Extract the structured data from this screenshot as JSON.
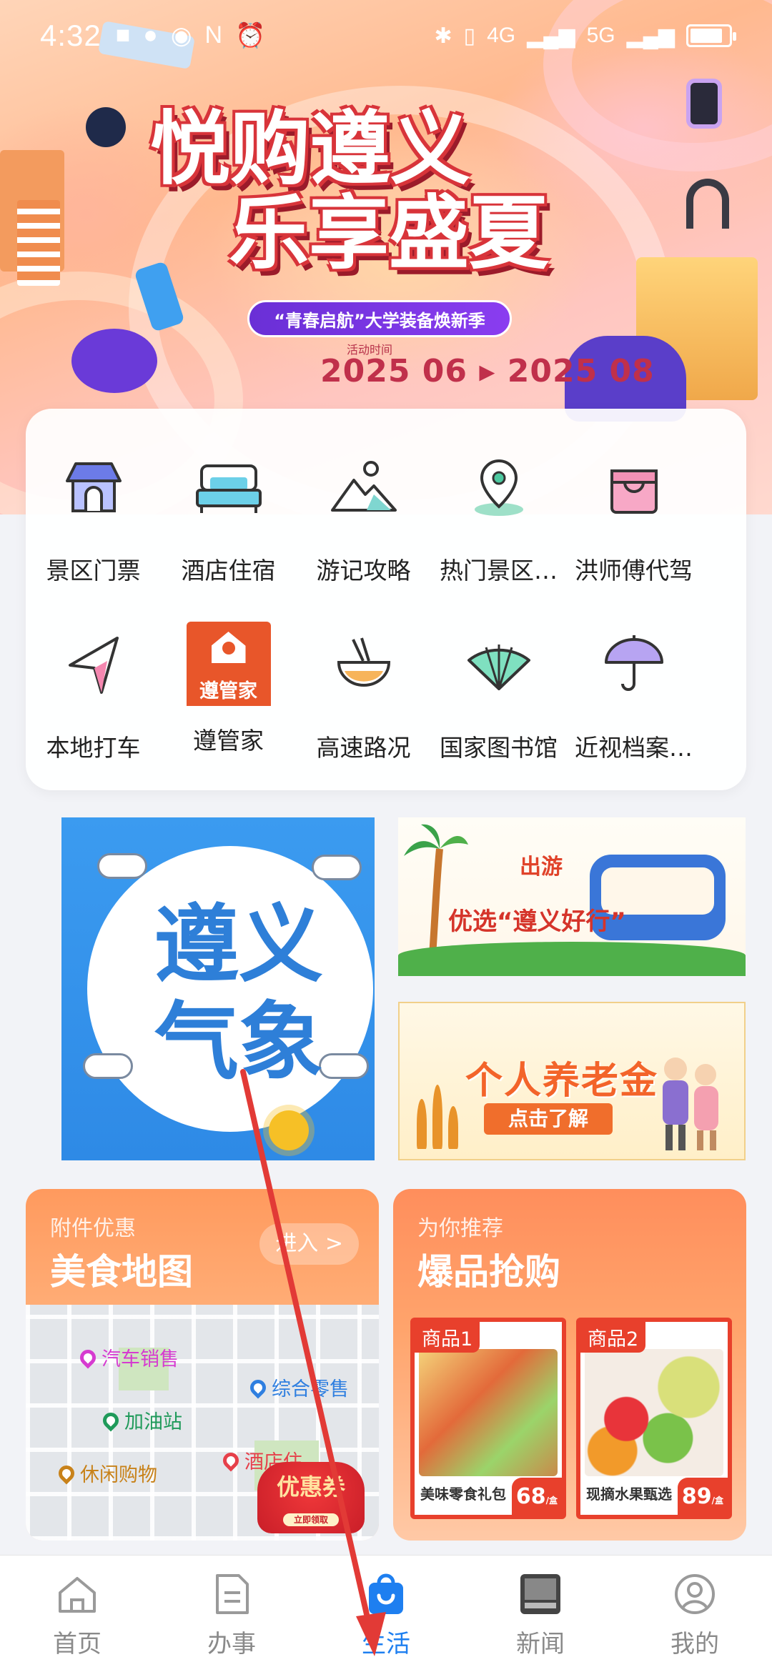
{
  "status_bar": {
    "time": "4:32",
    "network_4g": "4G",
    "network_5g": "5G",
    "battery_level": 0.85
  },
  "hero": {
    "title_line1": "悦购遵义",
    "title_line2": "乐享盛夏",
    "slogan": "“青春启航”大学装备焕新季",
    "date_label": "活动时间",
    "date_range": "2025 06 ▸ 2025 08"
  },
  "services": {
    "row1": [
      {
        "label": "景区门票",
        "icon": "scenic-ticket-icon"
      },
      {
        "label": "酒店住宿",
        "icon": "hotel-bed-icon"
      },
      {
        "label": "游记攻略",
        "icon": "mountain-icon"
      },
      {
        "label": "热门景区…",
        "icon": "location-pin-icon"
      },
      {
        "label": "洪师傅代驾",
        "icon": "shopping-bag-icon"
      }
    ],
    "row2": [
      {
        "label": "本地打车",
        "icon": "navigation-arrow-icon"
      },
      {
        "label": "遵管家",
        "icon": "zunguanjia-logo"
      },
      {
        "label": "高速路况",
        "icon": "noodle-bowl-icon"
      },
      {
        "label": "国家图书馆",
        "icon": "fan-icon"
      },
      {
        "label": "近视档案…",
        "icon": "umbrella-icon"
      }
    ],
    "logo_text": "遵管家"
  },
  "banners": {
    "weather_text_1": "遵义",
    "weather_text_2": "气象",
    "travel_kicker": "出游",
    "travel_title": "优选“遵义好行”",
    "pension_title": "个人养老金",
    "pension_button": "点击了解"
  },
  "promo_food": {
    "kicker": "附件优惠",
    "title": "美食地图",
    "enter": "进入 >",
    "pins": [
      {
        "label": "汽车销售",
        "color": "#d63bd0"
      },
      {
        "label": "综合零售",
        "color": "#2f7fe0"
      },
      {
        "label": "加油站",
        "color": "#1f9a5a"
      },
      {
        "label": "酒店住",
        "color": "#e6404a"
      },
      {
        "label": "休闲购物",
        "color": "#c8821a"
      }
    ],
    "coupon": "优惠券",
    "coupon_sub": "立即领取"
  },
  "promo_hot": {
    "kicker": "为你推荐",
    "title": "爆品抢购",
    "products": [
      {
        "tag": "商品1",
        "name": "美味零食礼包",
        "price": "68"
      },
      {
        "tag": "商品2",
        "name": "现摘水果甄选",
        "price": "89"
      }
    ],
    "price_unit": "/盒"
  },
  "bottom_nav": [
    {
      "label": "首页",
      "icon": "home-icon"
    },
    {
      "label": "办事",
      "icon": "document-icon"
    },
    {
      "label": "生活",
      "icon": "shopping-bag-icon"
    },
    {
      "label": "新闻",
      "icon": "news-icon"
    },
    {
      "label": "我的",
      "icon": "profile-icon"
    }
  ],
  "colors": {
    "accent_blue": "#1e7ff0",
    "promo_orange": "#ff8e5c",
    "annotation_red": "#e23a36"
  }
}
